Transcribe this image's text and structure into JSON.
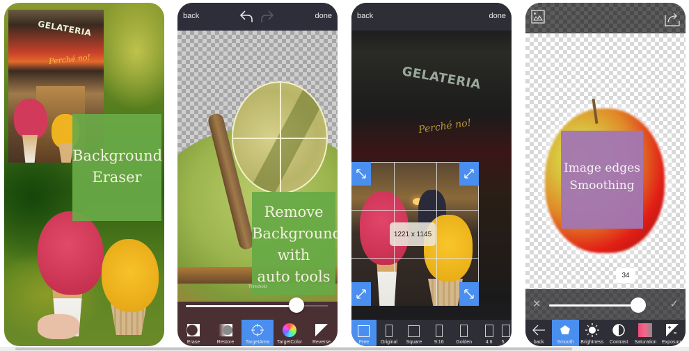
{
  "panels": [
    {
      "id": "eraser-showcase",
      "caption": "Background Eraser",
      "caption_lines": [
        "Background",
        "Eraser"
      ],
      "photo_sign_text": "GELATERIA",
      "photo_neon_text": "Perché no!"
    },
    {
      "id": "auto-tools",
      "topbar": {
        "back": "back",
        "done": "done",
        "undo_icon": "undo-icon",
        "redo_icon": "redo-icon",
        "redo_enabled": false
      },
      "caption_lines": [
        "Remove",
        "Background",
        "with",
        "auto tools"
      ],
      "slider": {
        "label": "Threshold",
        "value_fraction": 0.78
      },
      "tools": [
        {
          "label": "Erase",
          "icon": "erase-icon",
          "active": false
        },
        {
          "label": "Restore",
          "icon": "restore-icon",
          "active": false
        },
        {
          "label": "TargetArea",
          "icon": "crosshair-icon",
          "active": true
        },
        {
          "label": "TargetColor",
          "icon": "color-wheel-icon",
          "active": false
        },
        {
          "label": "Reverse",
          "icon": "reverse-icon",
          "active": false
        }
      ]
    },
    {
      "id": "crop",
      "topbar": {
        "back": "back",
        "done": "done"
      },
      "photo_sign_text": "GELATERIA",
      "photo_neon_text": "Perché no!",
      "crop_size": "1221 x 1145",
      "ratios": [
        {
          "label": "Free",
          "active": true
        },
        {
          "label": "Original",
          "active": false
        },
        {
          "label": "Square",
          "active": false
        },
        {
          "label": "9:16",
          "active": false
        },
        {
          "label": "Golden",
          "active": false
        },
        {
          "label": "4:6",
          "active": false
        },
        {
          "label": "5",
          "active": false
        }
      ]
    },
    {
      "id": "smoothing",
      "topbar": {
        "left_icon": "gallery-icon",
        "right_icon": "share-icon"
      },
      "caption_lines": [
        "Image edges",
        "Smoothing"
      ],
      "value": "34",
      "slider": {
        "value_fraction": 0.8,
        "cancel_icon": "close-icon",
        "confirm_icon": "check-icon"
      },
      "tools": [
        {
          "label": "back",
          "icon": "arrow-left-icon",
          "active": false
        },
        {
          "label": "Smooth",
          "icon": "smooth-icon",
          "active": true
        },
        {
          "label": "Brightness",
          "icon": "brightness-icon",
          "active": false
        },
        {
          "label": "Contrast",
          "icon": "contrast-icon",
          "active": false
        },
        {
          "label": "Saturation",
          "icon": "saturation-icon",
          "active": false
        },
        {
          "label": "Exposure",
          "icon": "exposure-icon",
          "active": false
        }
      ]
    }
  ],
  "colors": {
    "active_tool": "#4a8ff0",
    "green_card": "#68aa46",
    "purple_card": "#a276b2",
    "toolbar_dark": "#2e2e36"
  },
  "scrollbar": {
    "position_fraction": 0.0
  }
}
